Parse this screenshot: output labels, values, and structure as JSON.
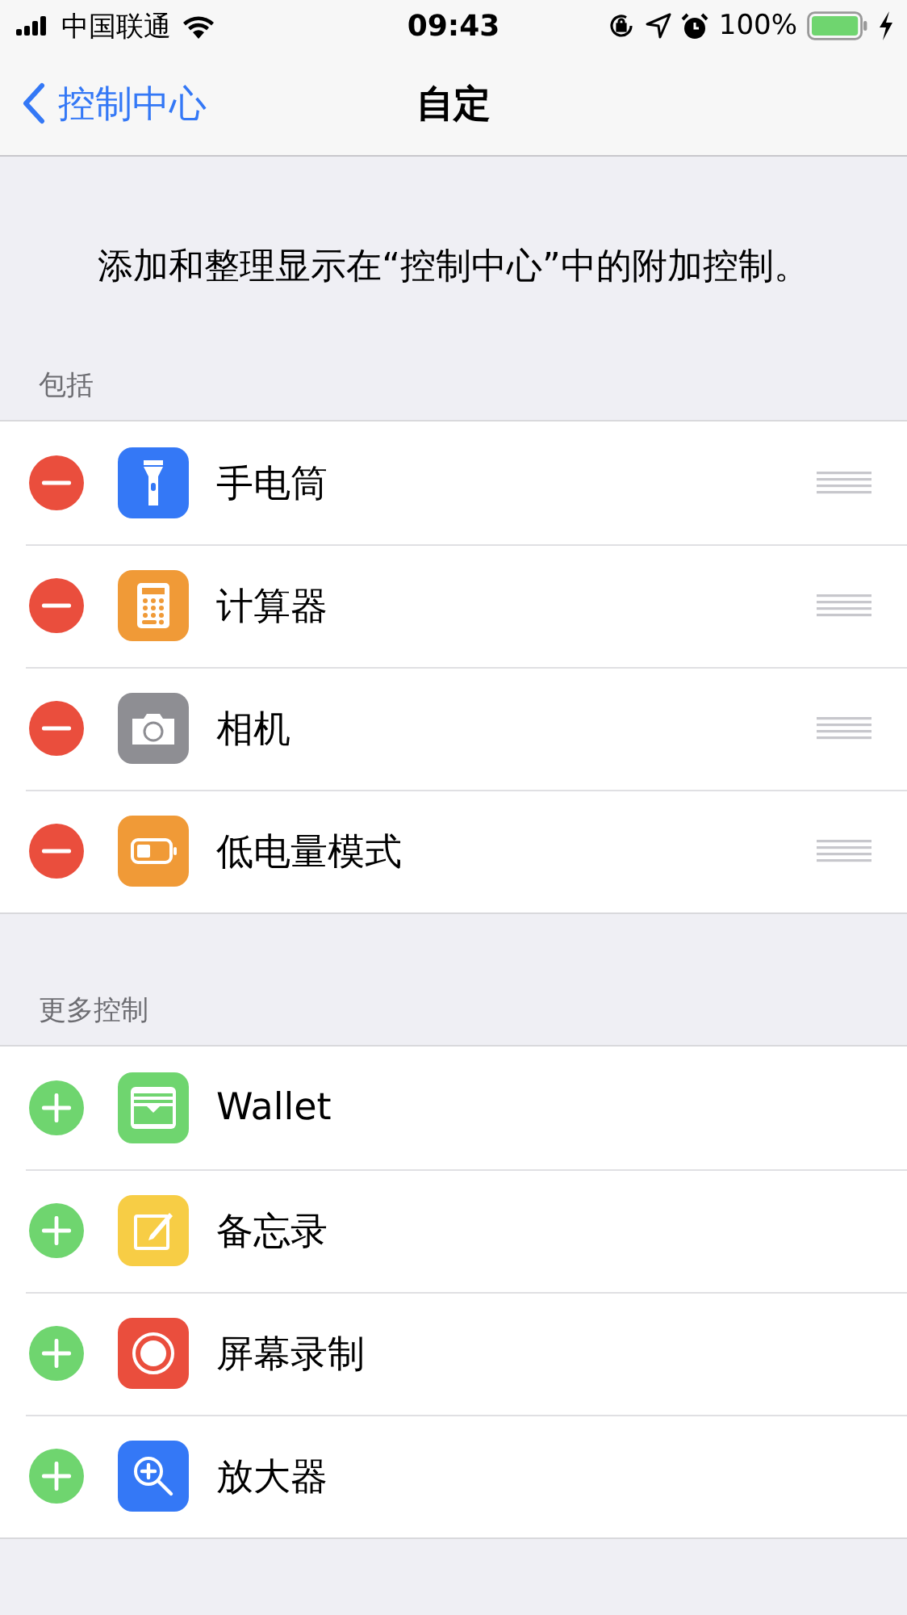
{
  "status_bar": {
    "carrier": "中国联通",
    "time": "09:43",
    "battery": "100%"
  },
  "nav": {
    "back": "控制中心",
    "title": "自定"
  },
  "description": "添加和整理显示在“控制中心”中的附加控制。",
  "sections": [
    {
      "kind": "included",
      "header": "包括",
      "items": [
        {
          "label": "手电筒",
          "color": "#3478f6"
        },
        {
          "label": "计算器",
          "color": "#f09a37"
        },
        {
          "label": "相机",
          "color": "#8e8e93"
        },
        {
          "label": "低电量模式",
          "color": "#f09a37"
        }
      ]
    },
    {
      "kind": "more",
      "header": "更多控制",
      "items": [
        {
          "label": "Wallet",
          "color": "#6fd56f"
        },
        {
          "label": "备忘录",
          "color": "#f7cd45"
        },
        {
          "label": "屏幕录制",
          "color": "#ea4e3d"
        },
        {
          "label": "放大器",
          "color": "#3478f6"
        }
      ]
    }
  ]
}
